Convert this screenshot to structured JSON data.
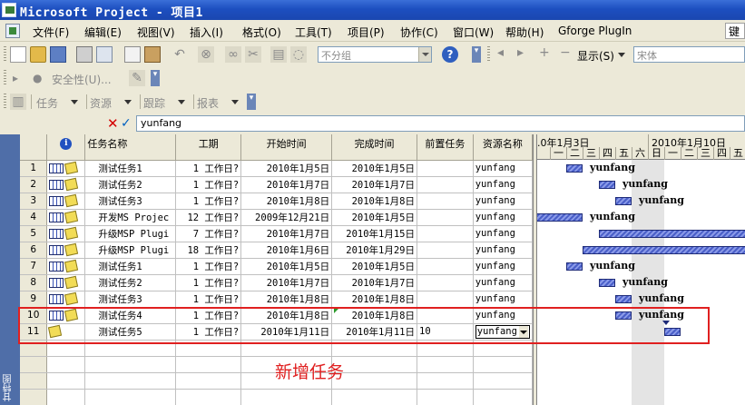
{
  "window": {
    "title": "Microsoft Project - 项目1"
  },
  "menu": [
    "文件(F)",
    "编辑(E)",
    "视图(V)",
    "插入(I)",
    "格式(O)",
    "工具(T)",
    "项目(P)",
    "协作(C)",
    "窗口(W)",
    "帮助(H)",
    "Gforge PlugIn"
  ],
  "menu_help_box": "键",
  "toolbar1": {
    "group_select": "不分组",
    "display_label": "显示(S)",
    "font_select": "宋体"
  },
  "toolbar2": {
    "security_label": "安全性(U)..."
  },
  "toolbar3": {
    "task_label": "任务",
    "resource_label": "资源",
    "track_label": "跟踪",
    "report_label": "报表"
  },
  "entry": {
    "value": "yunfang"
  },
  "viewbar": {
    "label": "甘特图"
  },
  "columns": [
    "任务名称",
    "工期",
    "开始时间",
    "完成时间",
    "前置任务",
    "资源名称"
  ],
  "rows": [
    {
      "id": "1",
      "name": "测试任务1",
      "duration": "1 工作日?",
      "start": "2010年1月5日",
      "finish": "2010年1月5日",
      "pred": "",
      "resource": "yunfang"
    },
    {
      "id": "2",
      "name": "测试任务2",
      "duration": "1 工作日?",
      "start": "2010年1月7日",
      "finish": "2010年1月7日",
      "pred": "",
      "resource": "yunfang"
    },
    {
      "id": "3",
      "name": "测试任务3",
      "duration": "1 工作日?",
      "start": "2010年1月8日",
      "finish": "2010年1月8日",
      "pred": "",
      "resource": "yunfang"
    },
    {
      "id": "4",
      "name": "开发MS Projec",
      "duration": "12 工作日?",
      "start": "2009年12月21日",
      "finish": "2010年1月5日",
      "pred": "",
      "resource": "yunfang"
    },
    {
      "id": "5",
      "name": "升级MSP Plugi",
      "duration": "7 工作日?",
      "start": "2010年1月7日",
      "finish": "2010年1月15日",
      "pred": "",
      "resource": "yunfang"
    },
    {
      "id": "6",
      "name": "升级MSP Plugi",
      "duration": "18 工作日?",
      "start": "2010年1月6日",
      "finish": "2010年1月29日",
      "pred": "",
      "resource": "yunfang"
    },
    {
      "id": "7",
      "name": "测试任务1",
      "duration": "1 工作日?",
      "start": "2010年1月5日",
      "finish": "2010年1月5日",
      "pred": "",
      "resource": "yunfang"
    },
    {
      "id": "8",
      "name": "测试任务2",
      "duration": "1 工作日?",
      "start": "2010年1月7日",
      "finish": "2010年1月7日",
      "pred": "",
      "resource": "yunfang"
    },
    {
      "id": "9",
      "name": "测试任务3",
      "duration": "1 工作日?",
      "start": "2010年1月8日",
      "finish": "2010年1月8日",
      "pred": "",
      "resource": "yunfang"
    },
    {
      "id": "10",
      "name": "测试任务4",
      "duration": "1 工作日?",
      "start": "2010年1月8日",
      "finish": "2010年1月8日",
      "pred": "",
      "resource": "yunfang"
    },
    {
      "id": "11",
      "name": "测试任务5",
      "duration": "1 工作日?",
      "start": "2010年1月11日",
      "finish": "2010年1月11日",
      "pred": "10",
      "resource": "yunfang"
    }
  ],
  "gantt": {
    "weeks": [
      ".0年1月3日",
      "2010年1月10日"
    ],
    "days_week1": [
      "一",
      "二",
      "三",
      "四",
      "五",
      "六"
    ],
    "days_week2": [
      "日",
      "一",
      "二",
      "三",
      "四",
      "五"
    ],
    "bar_label": "yunfang"
  },
  "annotation": {
    "text": "新增任务"
  },
  "colors": {
    "title_bar": "#1d4fc0",
    "chrome": "#ece9d8",
    "annotation": "#e02020",
    "gantt_bar": "#4a5fc8"
  }
}
